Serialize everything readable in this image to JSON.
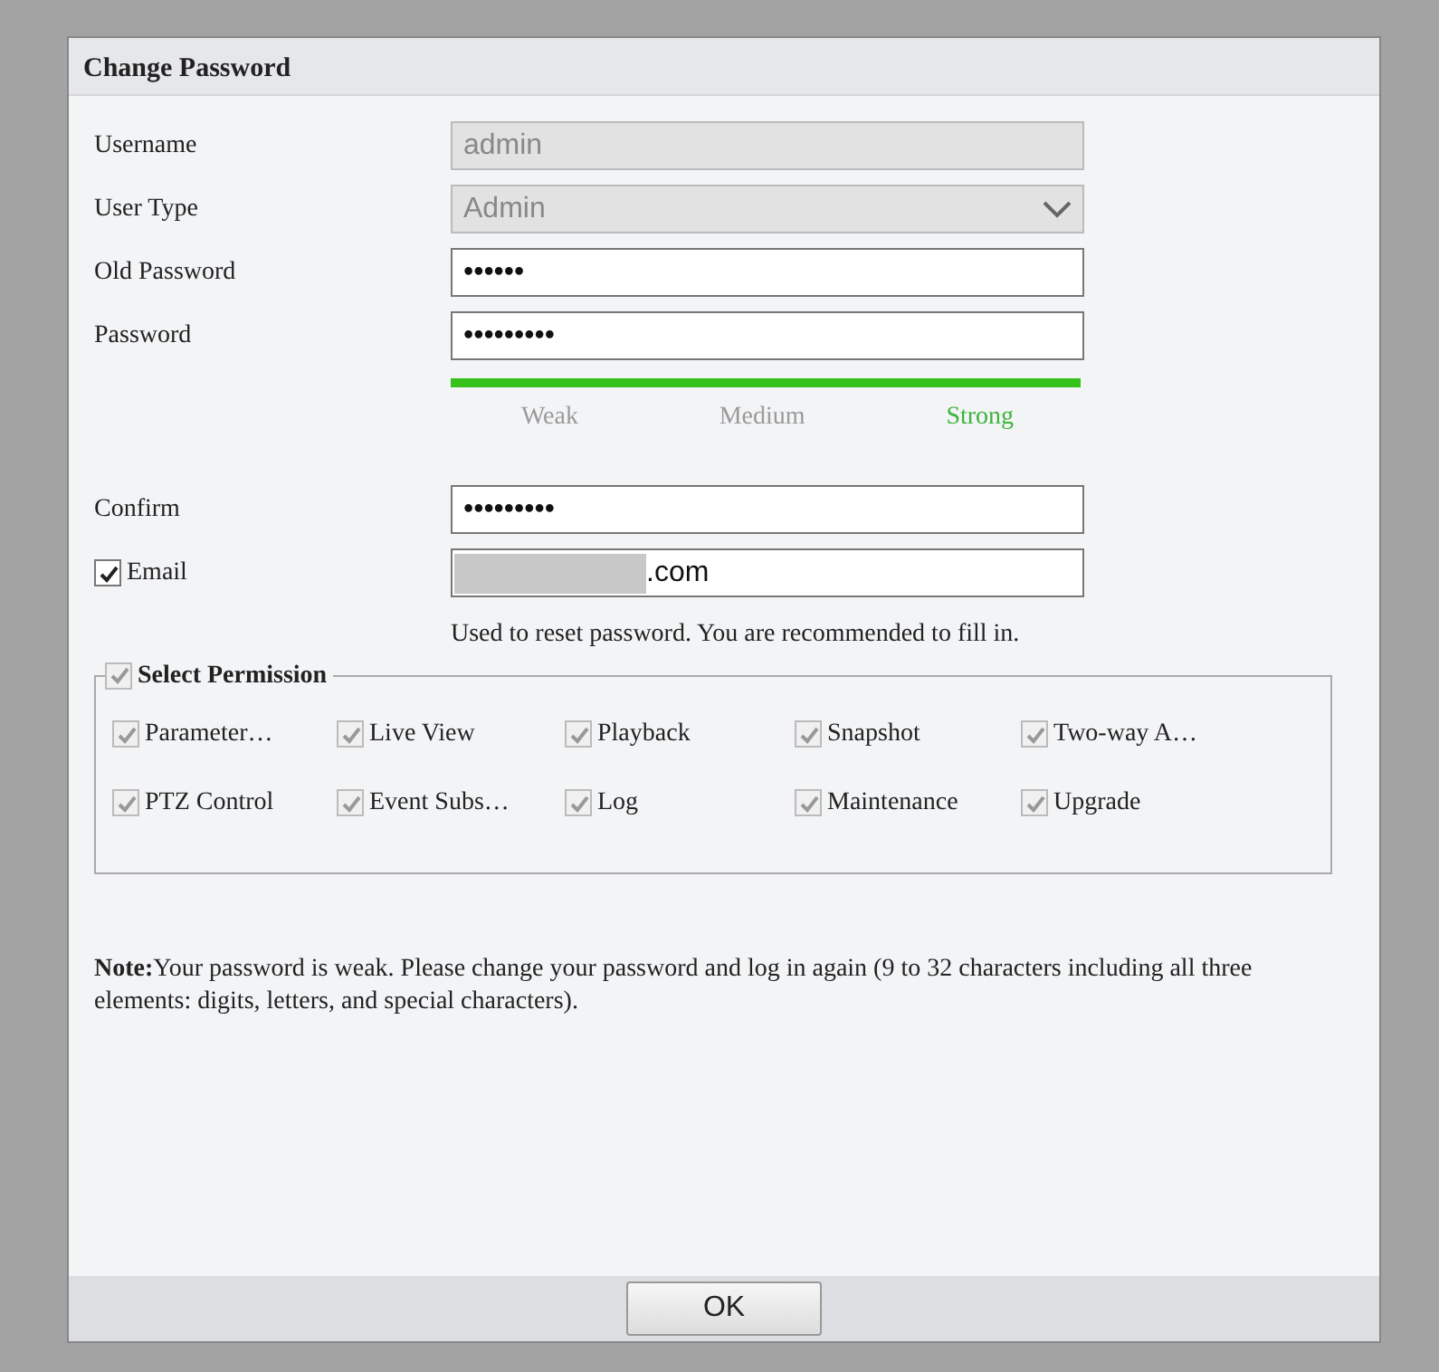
{
  "dialog": {
    "title": "Change Password"
  },
  "fields": [
    {
      "label": "Username",
      "kind": "text",
      "value": "admin",
      "disabled": true
    },
    {
      "label": "User Type",
      "kind": "select",
      "value": "Admin",
      "disabled": true
    },
    {
      "label": "Old Password",
      "kind": "text",
      "value": "••••••",
      "disabled": false
    },
    {
      "label": "Password",
      "kind": "text",
      "value": "•••••••••",
      "disabled": false
    }
  ],
  "strength": {
    "level": 1,
    "labels": [
      {
        "text": "Weak",
        "selected": false
      },
      {
        "text": "Medium",
        "selected": false
      },
      {
        "text": "Strong",
        "selected": true
      }
    ]
  },
  "confirm": {
    "label": "Confirm",
    "value": "•••••••••"
  },
  "email": {
    "label": "Email",
    "checked": true,
    "value": ".com",
    "redacted": true,
    "hint": "Used to reset password. You are recommended to fill in."
  },
  "permissions": {
    "title": "Select Permission",
    "checked": true,
    "disabled": true,
    "items": [
      {
        "label": "Parameter…",
        "checked": true
      },
      {
        "label": "Live View",
        "checked": true
      },
      {
        "label": "Playback",
        "checked": true
      },
      {
        "label": "Snapshot",
        "checked": true
      },
      {
        "label": "Two-way A…",
        "checked": true
      },
      {
        "label": "PTZ Control",
        "checked": true
      },
      {
        "label": "Event Subs…",
        "checked": true
      },
      {
        "label": "Log",
        "checked": true
      },
      {
        "label": "Maintenance",
        "checked": true
      },
      {
        "label": "Upgrade",
        "checked": true
      }
    ]
  },
  "note": "**Note:**Your password is weak. Please change your password and log in again (9 to 32 characters including all three elements: digits, letters, and special characters).",
  "buttons": [
    "OK"
  ]
}
